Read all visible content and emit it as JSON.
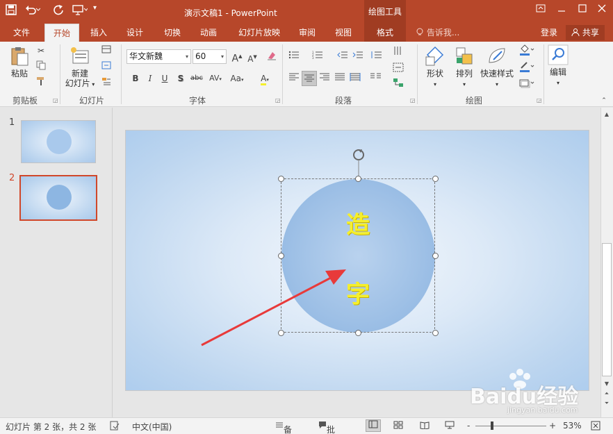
{
  "titlebar": {
    "title": "演示文稿1 - PowerPoint",
    "drawing_tools": "绘图工具",
    "save_icon": "save-icon",
    "undo_icon": "undo-icon",
    "redo_icon": "redo-icon",
    "present_icon": "present-from-start-icon"
  },
  "tabs": {
    "file": "文件",
    "home": "开始",
    "insert": "插入",
    "design": "设计",
    "transitions": "切换",
    "animations": "动画",
    "slideshow": "幻灯片放映",
    "review": "审阅",
    "view": "视图",
    "format": "格式",
    "tell_me": "告诉我...",
    "login": "登录",
    "share": "共享"
  },
  "ribbon": {
    "clipboard": {
      "label": "剪贴板",
      "paste": "粘贴"
    },
    "slides": {
      "label": "幻灯片",
      "new_slide_line1": "新建",
      "new_slide_line2": "幻灯片"
    },
    "font": {
      "label": "字体",
      "font_name": "华文新魏",
      "font_size": "60",
      "bold": "B",
      "italic": "I",
      "underline": "U",
      "shadow": "S",
      "strike": "abc",
      "spacing": "AV",
      "case": "Aa",
      "color_a": "A",
      "grow": "A",
      "shrink": "A"
    },
    "paragraph": {
      "label": "段落"
    },
    "drawing": {
      "label": "绘图",
      "shapes": "形状",
      "arrange": "排列",
      "quick_styles": "快速样式"
    },
    "editing": {
      "label": "编辑"
    }
  },
  "thumbnails": {
    "n1": "1",
    "n2": "2"
  },
  "slide": {
    "char1": "造",
    "char2": "字"
  },
  "statusbar": {
    "slide_info": "幻灯片 第 2 张，共 2 张",
    "language": "中文(中国)",
    "notes": "备注",
    "comments": "批注",
    "zoom_minus": "-",
    "zoom_plus": "+",
    "zoom": "53%"
  },
  "watermark": {
    "brand": "Baidu经验",
    "url": "jingyan.baidu.com"
  },
  "colors": {
    "accent": "#b7472a",
    "arrow": "#e83a3a",
    "text_fill": "#f5ef2c"
  }
}
